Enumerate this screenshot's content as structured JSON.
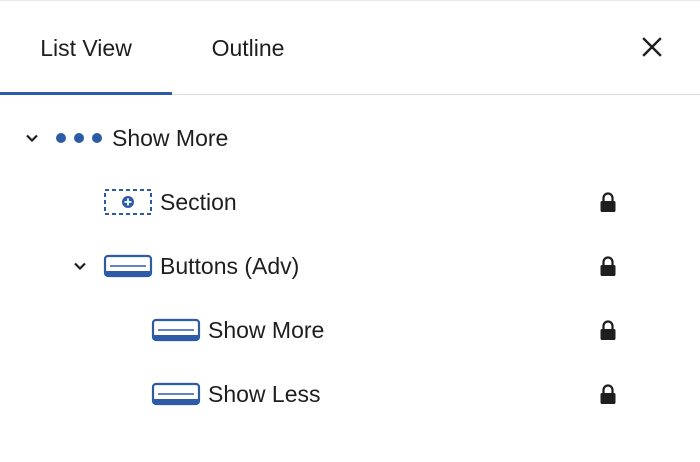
{
  "tabs": [
    {
      "label": "List View",
      "active": true
    },
    {
      "label": "Outline",
      "active": false
    }
  ],
  "close_icon": "close-icon",
  "accent_color": "#2d5ba5",
  "tree": [
    {
      "label": "Show More",
      "icon": "more-dots-icon",
      "expanded": true,
      "locked": false,
      "level": 1
    },
    {
      "label": "Section",
      "icon": "section-icon",
      "expanded": null,
      "locked": true,
      "level": 2
    },
    {
      "label": "Buttons (Adv)",
      "icon": "buttons-icon",
      "expanded": true,
      "locked": true,
      "level": 2
    },
    {
      "label": "Show More",
      "icon": "button-icon",
      "expanded": null,
      "locked": true,
      "level": 3
    },
    {
      "label": "Show Less",
      "icon": "button-icon",
      "expanded": null,
      "locked": true,
      "level": 3
    }
  ]
}
